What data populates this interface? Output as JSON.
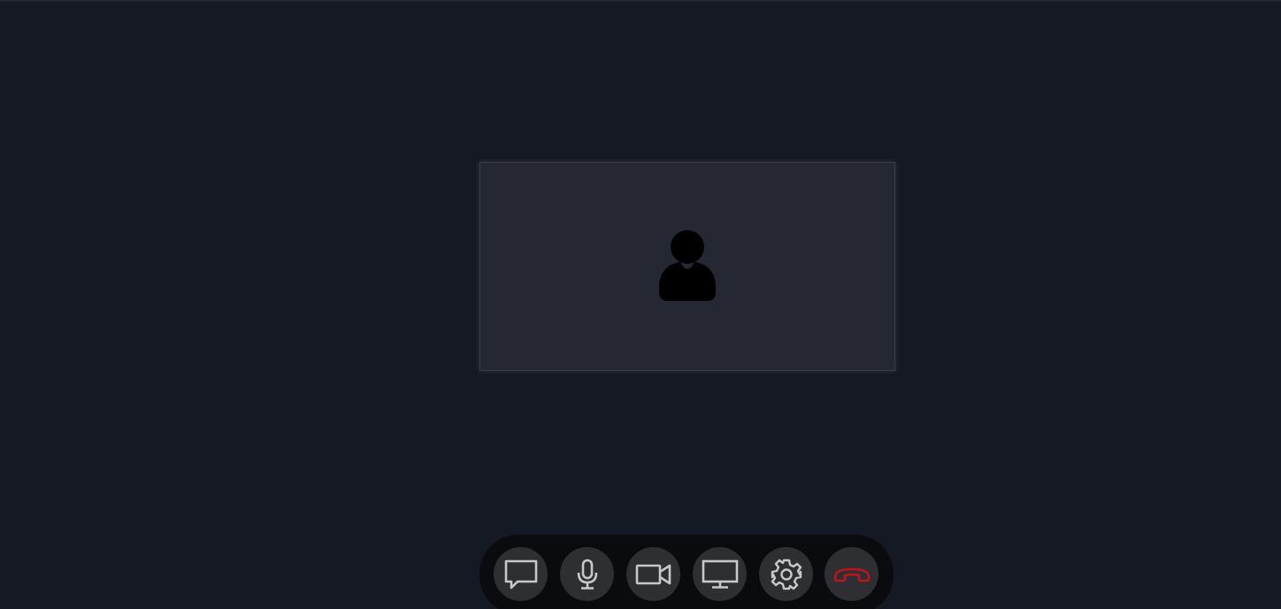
{
  "icons": {
    "participant": "user-silhouette-icon",
    "chat": "chat-bubble-icon",
    "microphone": "microphone-icon",
    "camera": "video-camera-icon",
    "screen_share": "monitor-icon",
    "settings": "gear-icon",
    "hang_up": "phone-hangup-icon"
  },
  "colors": {
    "background": "#141923",
    "tile": "#252833",
    "control_bar": "#0a0b0e",
    "button": "#2e2f33",
    "icon": "#c8c8cc",
    "hang_up": "#c0141c"
  }
}
